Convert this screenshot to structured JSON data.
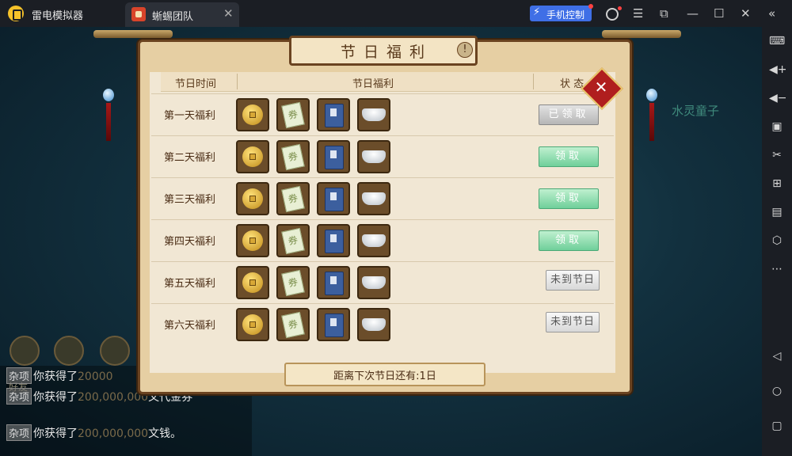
{
  "window": {
    "app_title": "雷电模拟器",
    "tab_label": "蜥蜴团队",
    "phone_control_label": "手机控制"
  },
  "icons": {
    "top_right": [
      "menu-icon",
      "restore-icon",
      "minimize-icon",
      "maximize-icon",
      "close-icon",
      "collapse-icon"
    ],
    "sidebar": [
      "keyboard-icon",
      "volume-up-icon",
      "volume-down-icon",
      "screenshot-icon",
      "scissors-icon",
      "add-window-icon",
      "apk-icon",
      "settings-icon",
      "more-icon",
      "back-icon",
      "home-icon",
      "recent-apps-icon"
    ]
  },
  "game": {
    "npc_name": "水灵童子",
    "friend_label": "好友",
    "chat": [
      {
        "tag": "杂项",
        "text": "你获得了",
        "amount": "20000",
        "tail": ""
      },
      {
        "tag": "杂项",
        "text": "你获得了",
        "amount": "200,000,000",
        "tail": "文代金券"
      },
      {
        "tag": "杂项",
        "text": "你获得了",
        "amount": "200,000,000",
        "tail": "文钱。"
      }
    ]
  },
  "dialog": {
    "title": "节日福利",
    "columns": {
      "time": "节日时间",
      "reward": "节日福利",
      "status": "状 态"
    },
    "rows": [
      {
        "name": "第一天福利",
        "status": "已领取",
        "state": "claimed"
      },
      {
        "name": "第二天福利",
        "status": "领取",
        "state": "available"
      },
      {
        "name": "第三天福利",
        "status": "领取",
        "state": "available"
      },
      {
        "name": "第四天福利",
        "status": "领取",
        "state": "available"
      },
      {
        "name": "第五天福利",
        "status": "未到节日",
        "state": "locked"
      },
      {
        "name": "第六天福利",
        "status": "未到节日",
        "state": "locked"
      }
    ],
    "reward_items": [
      "copper-coin-icon",
      "voucher-icon",
      "skill-book-icon",
      "silver-ingot-icon"
    ],
    "voucher_glyph": "券",
    "footer": "距离下次节日还有:1日"
  },
  "colors": {
    "button_green": "#6fcf9a",
    "button_gray": "#b6b6b6",
    "close_red": "#b01e1e",
    "accent_blue": "#3f6fe6"
  }
}
